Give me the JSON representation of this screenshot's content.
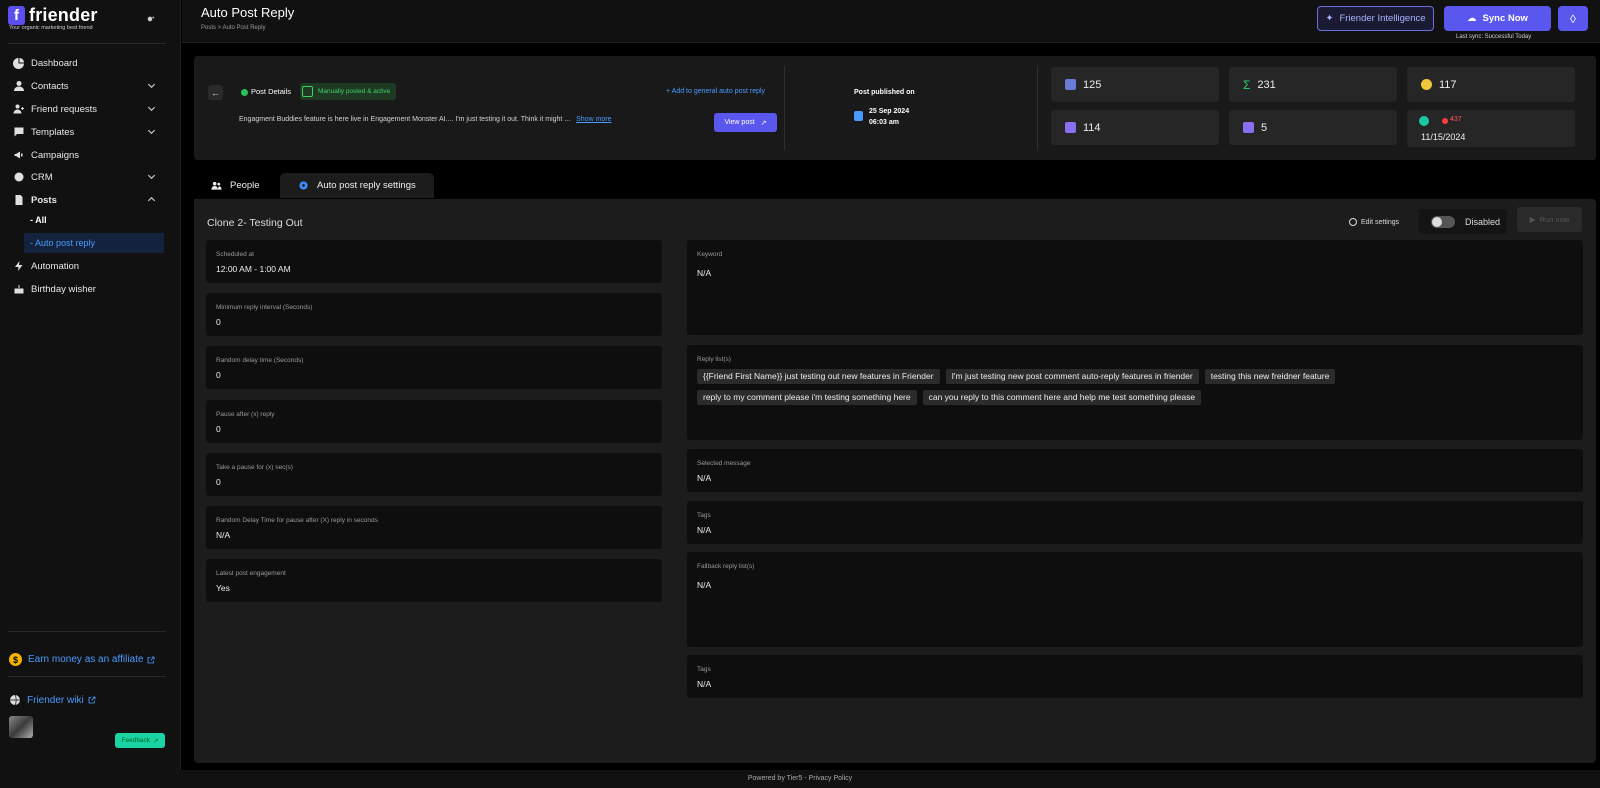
{
  "brand": {
    "name": "friender",
    "logo_letter": "f",
    "tagline": "Your organic marketing best friend"
  },
  "sidebar": {
    "items": [
      {
        "label": "Dashboard"
      },
      {
        "label": "Contacts"
      },
      {
        "label": "Friend requests"
      },
      {
        "label": "Templates"
      },
      {
        "label": "Campaigns"
      },
      {
        "label": "CRM"
      },
      {
        "label": "Posts"
      },
      {
        "label": "Automation"
      },
      {
        "label": "Birthday wisher"
      }
    ],
    "posts_sub": [
      {
        "label": "- All"
      },
      {
        "label": "- Auto post reply"
      }
    ],
    "affiliate": "Earn money as an affiliate",
    "wiki": "Friender wiki",
    "feedback": "Feedback"
  },
  "header": {
    "title": "Auto Post Reply",
    "breadcrumb": "Posts  >  Auto Post Reply",
    "intelligence_label": "Friender Intelligence",
    "sync_label": "Sync Now",
    "last_sync": "Last sync: Successful Today"
  },
  "post": {
    "details_label": "Post Details",
    "status": "Manually posted & active",
    "add_link": "+ Add to general auto post reply",
    "excerpt": "Engagment Buddies feature is here live in Engagement Monster AI.... I'm just testing it out. Think it might ...",
    "show_more": "Show more",
    "view_post": "View post",
    "published_label": "Post published on",
    "published_date": "25 Sep 2024",
    "published_time": "06:03 am"
  },
  "stats": {
    "reach": "125",
    "total": "231",
    "reactions": "117",
    "comments": "114",
    "replies": "5",
    "red_count": "437",
    "date": "11/15/2024"
  },
  "tabs": [
    {
      "label": "People"
    },
    {
      "label": "Auto post reply settings"
    }
  ],
  "settings": {
    "title": "Clone 2- Testing Out",
    "edit_label": "Edit settings",
    "toggle_label": "Disabled",
    "run_now": "Run now",
    "left": [
      {
        "label": "Scheduled at",
        "value": "12:00 AM - 1:00 AM"
      },
      {
        "label": "Minimum reply interval (Seconds)",
        "value": "0"
      },
      {
        "label": "Random delay time (Seconds)",
        "value": "0"
      },
      {
        "label": "Pause after (x) reply",
        "value": "0"
      },
      {
        "label": "Take a pause for (x) sec(s)",
        "value": "0"
      },
      {
        "label": "Random Delay Time for pause after (X) reply in seconds",
        "value": "N/A"
      },
      {
        "label": "Latest post engagement",
        "value": "Yes"
      }
    ],
    "keyword": {
      "label": "Keyword",
      "value": "N/A"
    },
    "reply_list": {
      "label": "Reply list(s)",
      "chips": [
        "{{Friend First Name}} just testing out new features in Friender",
        "I'm just testing new post comment auto-reply features in friender",
        "testing this new freidner feature",
        "reply to my comment please i'm testing something here",
        "can you reply to this comment here and help me test something please"
      ]
    },
    "selected_message": {
      "label": "Selected message",
      "value": "N/A"
    },
    "tags1": {
      "label": "Tags",
      "value": "N/A"
    },
    "fallback": {
      "label": "Fallback reply list(s)",
      "value": "N/A"
    },
    "tags2": {
      "label": "Tags",
      "value": "N/A"
    }
  },
  "footer": "Powered by Tier5 - Privacy Policy",
  "colors": {
    "accent": "#5a57ee",
    "link": "#4a9bff",
    "success": "#3fd06a",
    "bg": "#000000"
  }
}
